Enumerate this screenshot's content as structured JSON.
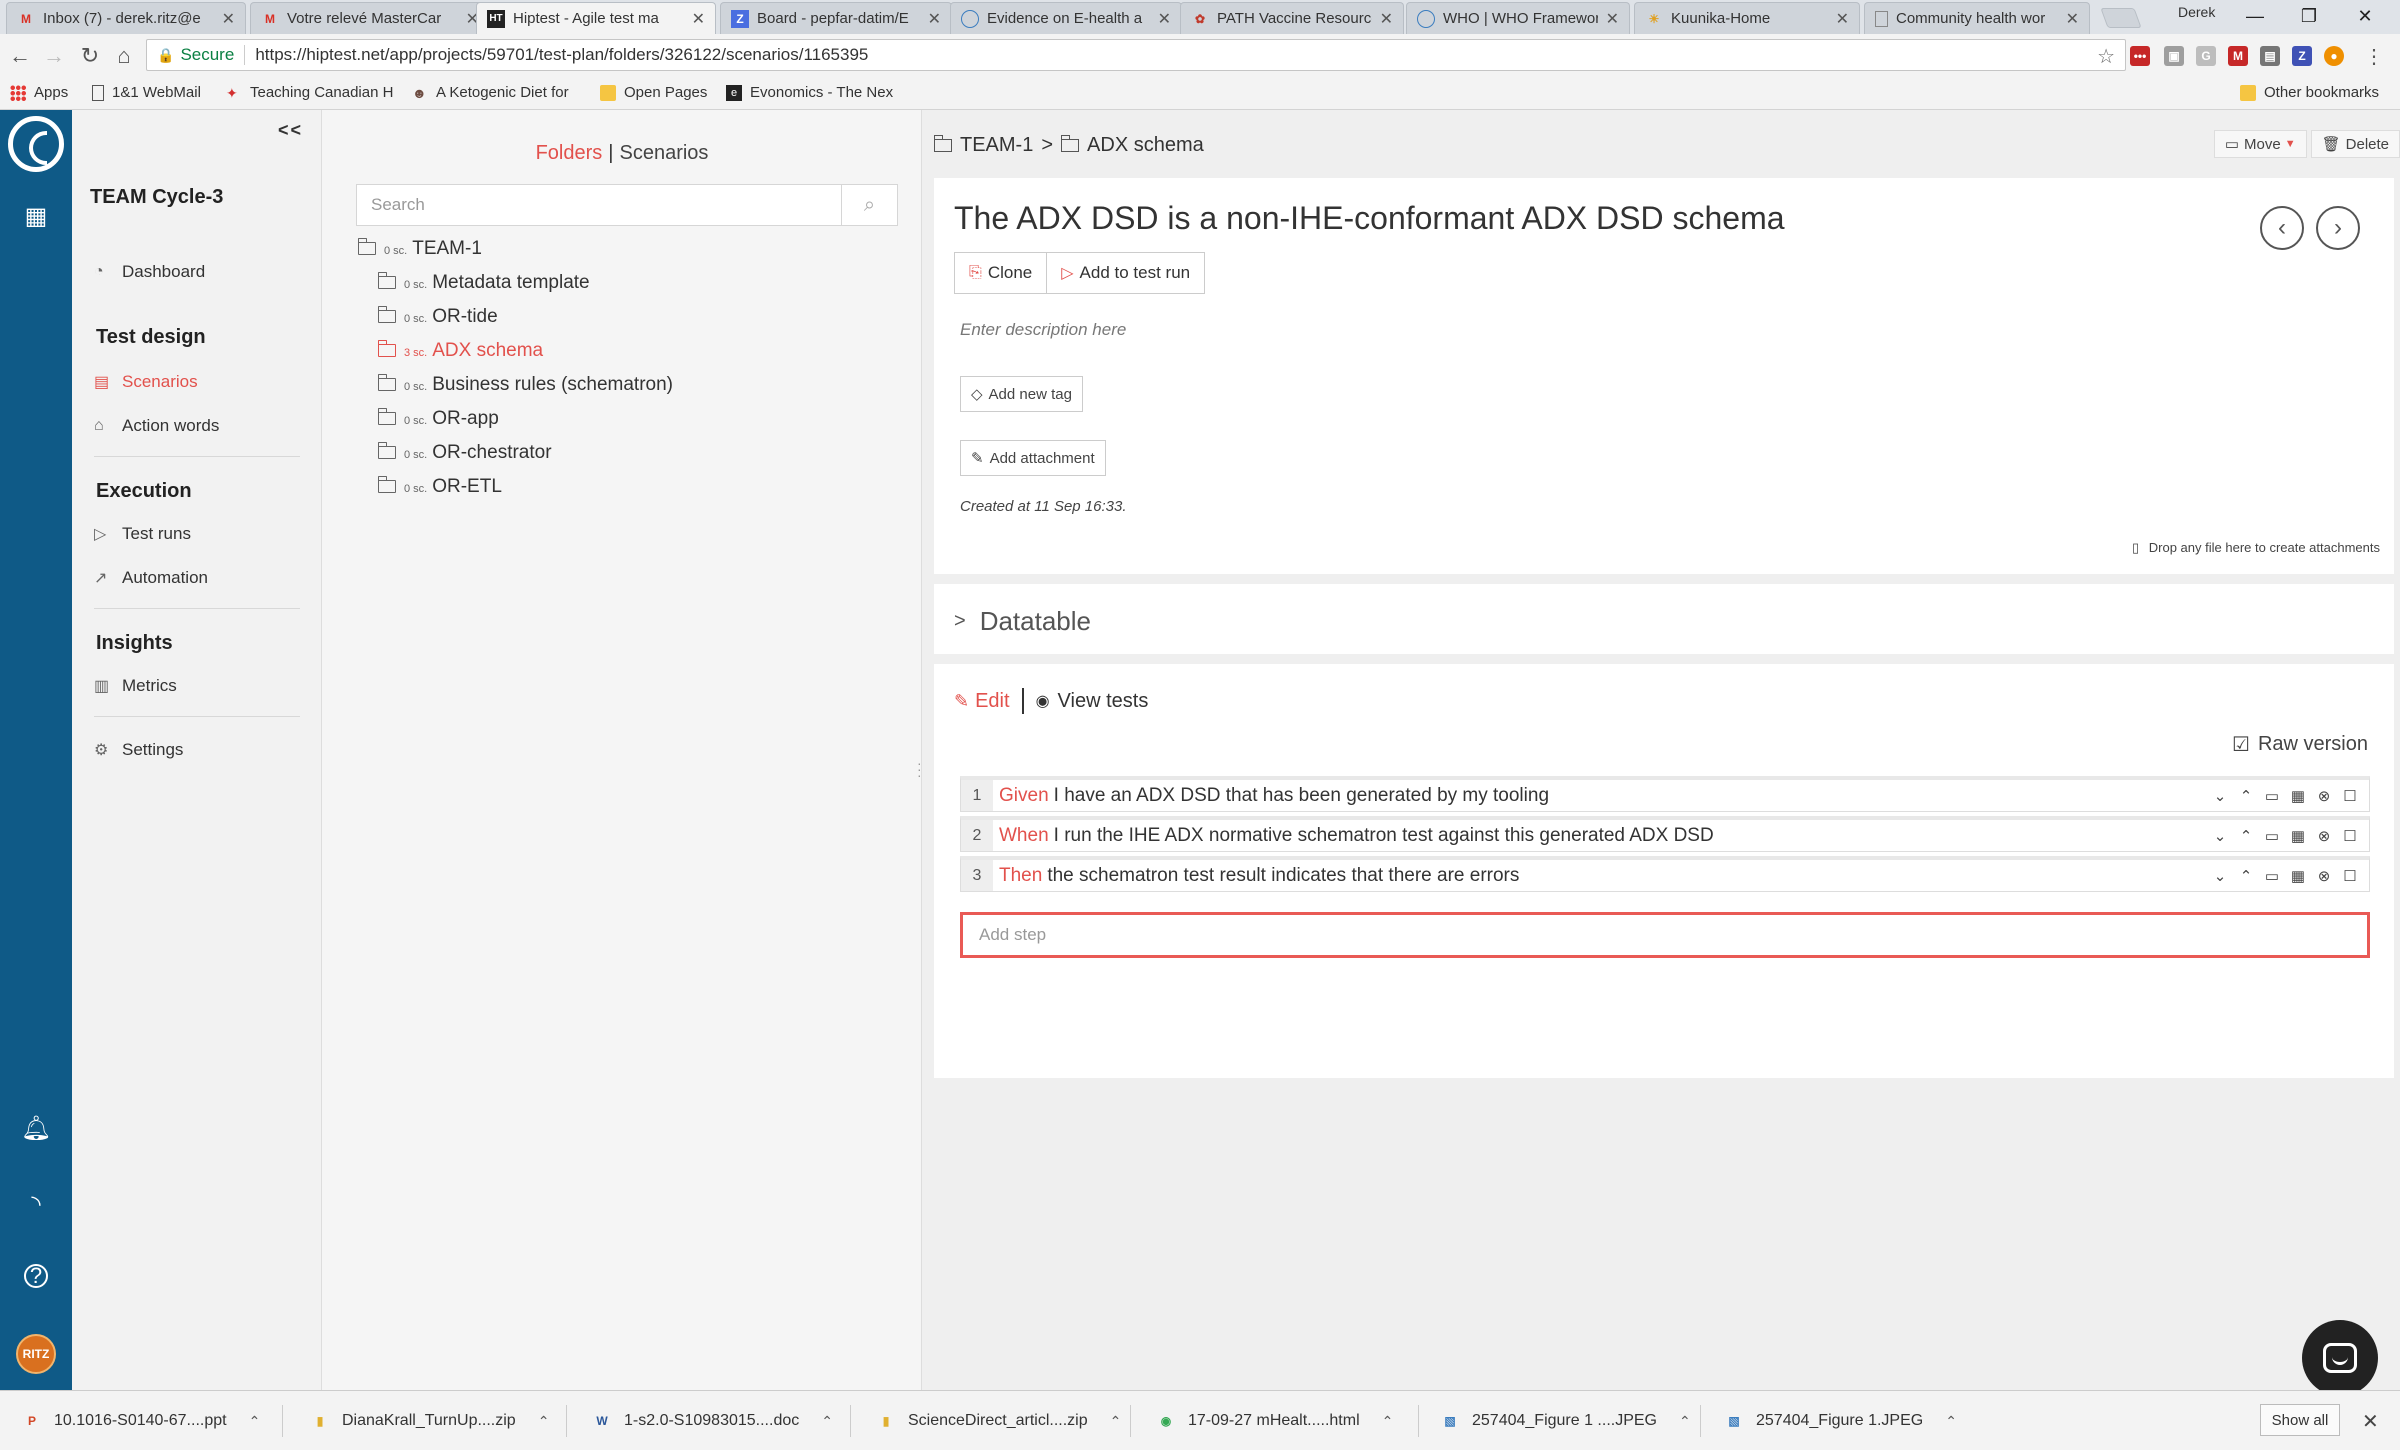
{
  "browser": {
    "tabs": [
      {
        "label": "Inbox (7) - derek.ritz@e",
        "icon": "gmail-icon",
        "fav": "M",
        "fav_color": "#d93025"
      },
      {
        "label": "Votre relevé MasterCar",
        "icon": "gmail-icon",
        "fav": "M",
        "fav_color": "#d93025"
      },
      {
        "label": "Hiptest - Agile test ma",
        "icon": "hiptest-icon",
        "fav": "HT",
        "fav_color": "#222222"
      },
      {
        "label": "Board - pepfar-datim/E",
        "icon": "zenhub-icon",
        "fav": "Z",
        "fav_color": "#4a6ee0"
      },
      {
        "label": "Evidence on E-health a",
        "icon": "who-icon",
        "fav": "◌",
        "fav_color": "#3b7dbf"
      },
      {
        "label": "PATH Vaccine Resource",
        "icon": "path-icon",
        "fav": "❀",
        "fav_color": "#c0392b"
      },
      {
        "label": "WHO | WHO Framewor",
        "icon": "who-icon",
        "fav": "◌",
        "fav_color": "#3b7dbf"
      },
      {
        "label": "Kuunika-Home",
        "icon": "kuunika-icon",
        "fav": "☀",
        "fav_color": "#e0a020"
      },
      {
        "label": "Community health wor",
        "icon": "doc-icon",
        "fav": "□",
        "fav_color": "#666666"
      }
    ],
    "profile": "Derek",
    "secure_label": "Secure",
    "url": "https://hiptest.net/app/projects/59701/test-plan/folders/326122/scenarios/1165395",
    "bookmarks": [
      {
        "label": "Apps",
        "icon": "apps-grid-icon"
      },
      {
        "label": "1&1 WebMail",
        "icon": "page-icon"
      },
      {
        "label": "Teaching Canadian H",
        "icon": "maple-leaf-icon"
      },
      {
        "label": "A Ketogenic Diet for",
        "icon": "person-icon"
      },
      {
        "label": "Open Pages",
        "icon": "folder-icon"
      },
      {
        "label": "Evonomics - The Nex",
        "icon": "evonomics-icon"
      },
      {
        "label": "Other bookmarks",
        "icon": "folder-icon"
      }
    ]
  },
  "sidebar": {
    "collapse_label": "<<",
    "project": "TEAM Cycle-3",
    "dashboard": "Dashboard",
    "test_design": "Test design",
    "scenarios": "Scenarios",
    "action_words": "Action words",
    "execution": "Execution",
    "test_runs": "Test runs",
    "automation": "Automation",
    "insights": "Insights",
    "metrics": "Metrics",
    "settings": "Settings"
  },
  "tree": {
    "tab_folders": "Folders",
    "tab_scenarios": "Scenarios",
    "search_placeholder": "Search",
    "root": {
      "count": "0 sc.",
      "label": "TEAM-1"
    },
    "children": [
      {
        "count": "0 sc.",
        "label": "Metadata template"
      },
      {
        "count": "0 sc.",
        "label": "OR-tide"
      },
      {
        "count": "3 sc.",
        "label": "ADX schema",
        "active": true
      },
      {
        "count": "0 sc.",
        "label": "Business rules (schematron)"
      },
      {
        "count": "0 sc.",
        "label": "OR-app"
      },
      {
        "count": "0 sc.",
        "label": "OR-chestrator"
      },
      {
        "count": "0 sc.",
        "label": "OR-ETL"
      }
    ]
  },
  "main": {
    "breadcrumb_root": "TEAM-1",
    "breadcrumb_sep": ">",
    "breadcrumb_current": "ADX schema",
    "move_label": "Move",
    "delete_label": "Delete",
    "title": "The ADX DSD is a non-IHE-conformant ADX DSD schema",
    "clone_label": "Clone",
    "add_to_run_label": "Add to test run",
    "description_placeholder": "Enter description here",
    "add_tag_label": "Add new tag",
    "add_attachment_label": "Add attachment",
    "created": "Created at 11 Sep 16:33.",
    "drop_hint": "Drop any file here to create attachments",
    "datatable_label": "Datatable",
    "edit_label": "Edit",
    "view_tests_label": "View tests",
    "raw_version_label": "Raw version",
    "steps": [
      {
        "num": "1",
        "keyword": "Given",
        "text": "I have an ADX DSD that has been generated by my tooling"
      },
      {
        "num": "2",
        "keyword": "When",
        "text": "I run the IHE ADX normative schematron test against this generated ADX DSD"
      },
      {
        "num": "3",
        "keyword": "Then",
        "text": "the schematron test result indicates that there are errors"
      }
    ],
    "add_step_placeholder": "Add step"
  },
  "downloads": {
    "items": [
      {
        "label": "10.1016-S0140-67....ppt",
        "icon": "ppt-file-icon"
      },
      {
        "label": "DianaKrall_TurnUp....zip",
        "icon": "zip-file-icon"
      },
      {
        "label": "1-s2.0-S10983015....doc",
        "icon": "doc-file-icon"
      },
      {
        "label": "ScienceDirect_articl....zip",
        "icon": "zip-file-icon"
      },
      {
        "label": "17-09-27 mHealt.....html",
        "icon": "chrome-file-icon"
      },
      {
        "label": "257404_Figure 1 ....JPEG",
        "icon": "image-file-icon"
      },
      {
        "label": "257404_Figure 1.JPEG",
        "icon": "image-file-icon"
      }
    ],
    "show_all_label": "Show all"
  },
  "colors": {
    "accent": "#e2514c",
    "rail": "#0f5a87"
  }
}
